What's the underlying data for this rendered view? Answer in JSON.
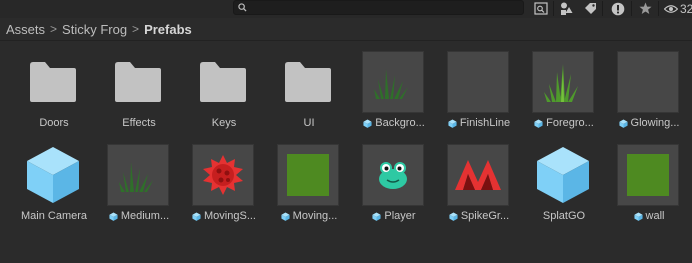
{
  "toolbar": {
    "search": {
      "value": "",
      "placeholder": ""
    },
    "buttons": [
      {
        "name": "search-by-type-button",
        "icon": "search-window-icon"
      },
      {
        "name": "search-by-label-button",
        "icon": "label-tag-icon"
      },
      {
        "name": "log-types-button",
        "icon": "warning-icon"
      },
      {
        "name": "favorites-button",
        "icon": "star-icon"
      }
    ],
    "hidden_count": "32"
  },
  "breadcrumb": {
    "items": [
      "Assets",
      "Sticky Frog",
      "Prefabs"
    ],
    "separator": ">"
  },
  "assets": [
    {
      "label": "Doors",
      "icon": "folder-icon",
      "kind": "folder",
      "prefab": false
    },
    {
      "label": "Effects",
      "icon": "folder-icon",
      "kind": "folder",
      "prefab": false
    },
    {
      "label": "Keys",
      "icon": "folder-icon",
      "kind": "folder",
      "prefab": false
    },
    {
      "label": "UI",
      "icon": "folder-icon",
      "kind": "folder",
      "prefab": false
    },
    {
      "label": "Backgro...",
      "icon": "grass-dark-icon",
      "kind": "thumb",
      "prefab": true
    },
    {
      "label": "FinishLine",
      "icon": "empty-thumbnail",
      "kind": "thumb",
      "prefab": true
    },
    {
      "label": "Foregro...",
      "icon": "grass-bright-icon",
      "kind": "thumb",
      "prefab": true
    },
    {
      "label": "Glowing...",
      "icon": "empty-thumbnail",
      "kind": "thumb",
      "prefab": true
    },
    {
      "label": "Main Camera",
      "icon": "prefab-cube-icon",
      "kind": "cube",
      "prefab": false
    },
    {
      "label": "Medium...",
      "icon": "grass-dark-icon",
      "kind": "thumb",
      "prefab": true
    },
    {
      "label": "MovingS...",
      "icon": "spiked-ball-icon",
      "kind": "thumb",
      "prefab": true
    },
    {
      "label": "Moving...",
      "icon": "green-square-icon",
      "kind": "thumb",
      "prefab": true
    },
    {
      "label": "Player",
      "icon": "frog-icon",
      "kind": "thumb",
      "prefab": true
    },
    {
      "label": "SpikeGr...",
      "icon": "spike-icon",
      "kind": "thumb",
      "prefab": true
    },
    {
      "label": "SplatGO",
      "icon": "prefab-cube-icon",
      "kind": "cube",
      "prefab": false
    },
    {
      "label": "wall",
      "icon": "green-square-icon",
      "kind": "thumb",
      "prefab": true
    }
  ],
  "colors": {
    "prefab_blue": "#7fd0f7",
    "folder_grey": "#c2c2c2",
    "grass_dark": "#2f6f2a",
    "grass_bright": "#4f9a2c",
    "green_square": "#4e8a21",
    "spike_red": "#e53232",
    "frog_teal": "#2ec9a3"
  }
}
